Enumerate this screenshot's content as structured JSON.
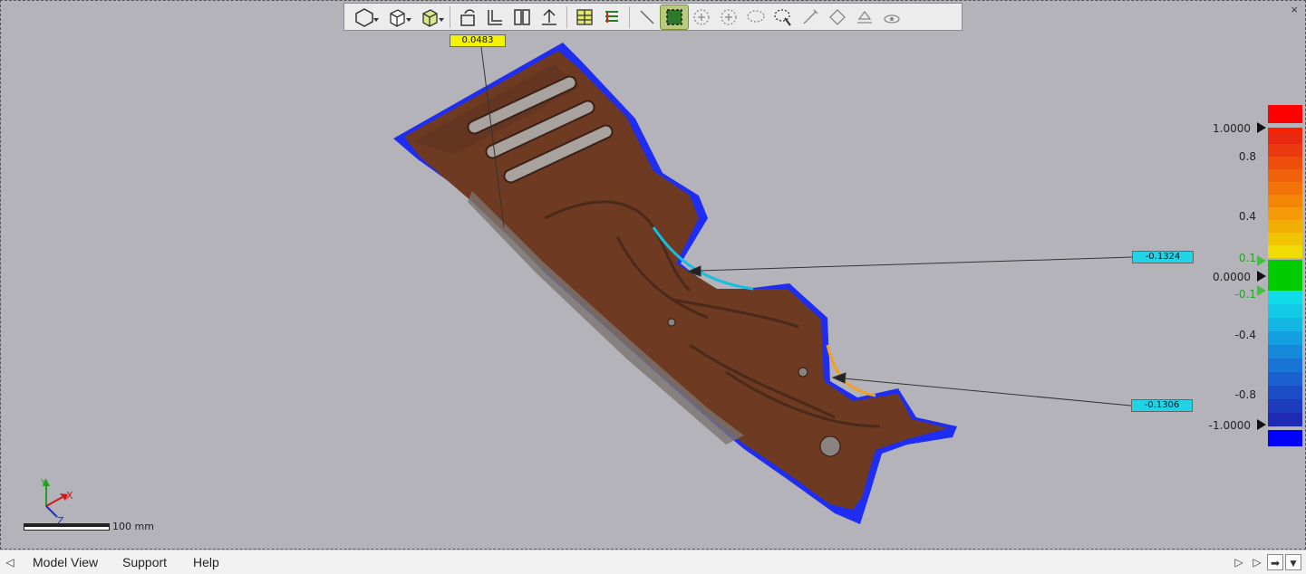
{
  "window": {
    "close_glyph": "×"
  },
  "toolbar": {
    "buttons": [
      {
        "name": "view-orient-icon",
        "dropdown": true
      },
      {
        "name": "cube-view-icon",
        "dropdown": true
      },
      {
        "name": "iso-cube-icon",
        "dropdown": true
      },
      {
        "name": "rotate-left-icon"
      },
      {
        "name": "flip-icon"
      },
      {
        "name": "split-view-icon"
      },
      {
        "name": "align-icon"
      },
      {
        "name": "grid-icon"
      },
      {
        "name": "list-icon"
      },
      {
        "name": "line-tool-icon"
      },
      {
        "name": "select-rect-icon",
        "active": true
      },
      {
        "name": "add-circle-icon"
      },
      {
        "name": "add-circle-2-icon"
      },
      {
        "name": "lasso-icon"
      },
      {
        "name": "lasso-select-icon"
      },
      {
        "name": "edit-icon"
      },
      {
        "name": "plane-icon"
      },
      {
        "name": "cut-icon"
      },
      {
        "name": "hide-icon"
      }
    ]
  },
  "annotations": [
    {
      "id": "a1",
      "value": "0.0483",
      "color": "yellow"
    },
    {
      "id": "a2",
      "value": "-0.1324",
      "color": "cyan"
    },
    {
      "id": "a3",
      "value": "-0.1306",
      "color": "cyan"
    }
  ],
  "color_bar": {
    "over_color": "#ff0000",
    "under_color": "#0000ff",
    "nominal_color": "#00cc00",
    "upper_colors": [
      "#e8290f",
      "#eb3a0f",
      "#ee4e0c",
      "#f0620a",
      "#f27408",
      "#f38607",
      "#f49a06",
      "#f1ae05",
      "#f1c503",
      "#efdc02"
    ],
    "lower_colors": [
      "#10dbe8",
      "#12c9e6",
      "#13b5e3",
      "#149fe0",
      "#1689db",
      "#1875d5",
      "#1a60ce",
      "#1b4dc6",
      "#1c3bbd",
      "#1e2ab4"
    ],
    "labels": {
      "max": "1.0000",
      "p08": "0.8",
      "p04": "0.4",
      "p01": "0.1",
      "zero": "0.0000",
      "n01": "-0.1",
      "n04": "-0.4",
      "n08": "-0.8",
      "min": "-1.0000"
    }
  },
  "axis": {
    "x": "X",
    "y": "Y",
    "z": "Z"
  },
  "scale": {
    "label": "100 mm"
  },
  "tabs": [
    {
      "label": "Model View"
    },
    {
      "label": "Support"
    },
    {
      "label": "Help"
    }
  ]
}
